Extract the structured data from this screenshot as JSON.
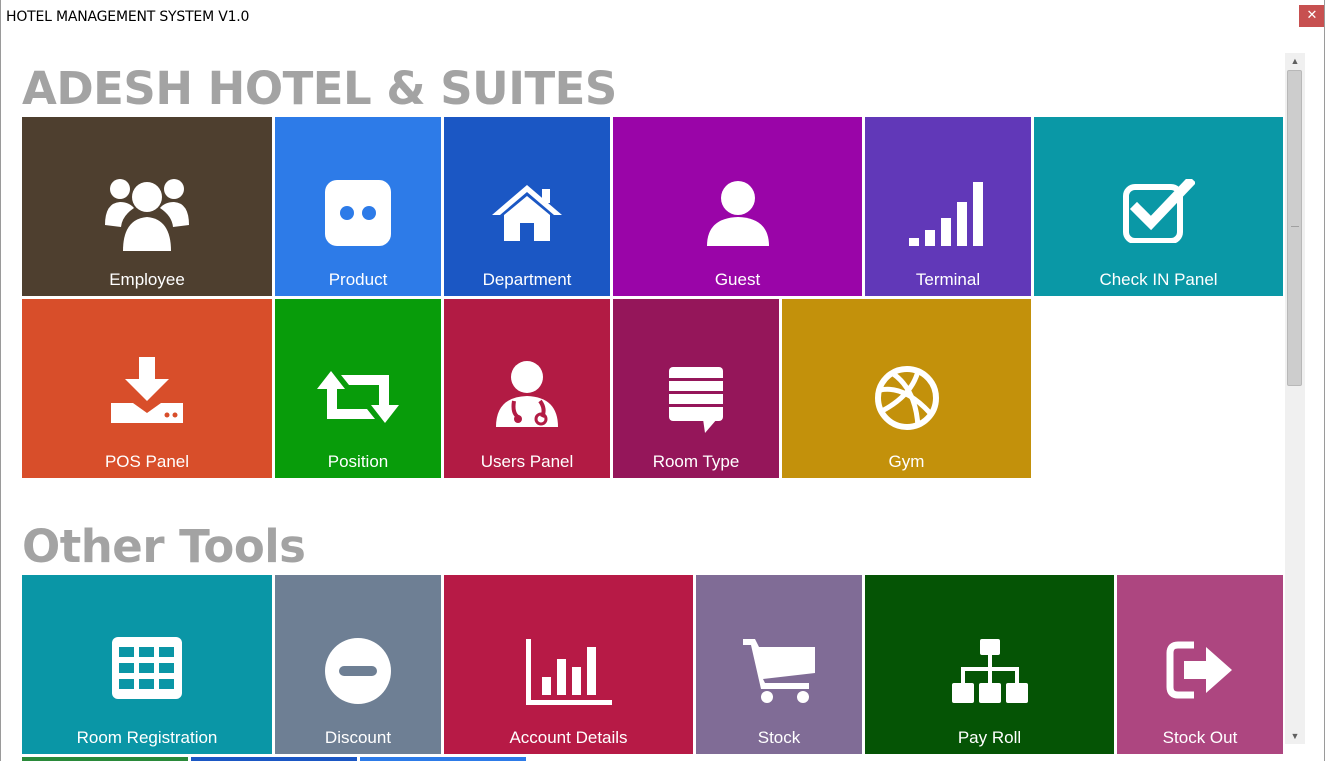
{
  "window": {
    "title": "HOTEL MANAGEMENT SYSTEM V1.0",
    "close_glyph": "✕"
  },
  "sections": {
    "main_heading": "ADESH HOTEL & SUITES",
    "other_heading": "Other Tools"
  },
  "tiles": {
    "employee": {
      "label": "Employee",
      "color": "#4e3f2f",
      "icon": "users-icon"
    },
    "product": {
      "label": "Product",
      "color": "#2d7be8",
      "icon": "flickr-icon"
    },
    "department": {
      "label": "Department",
      "color": "#1b57c4",
      "icon": "home-icon"
    },
    "guest": {
      "label": "Guest",
      "color": "#9a05a8",
      "icon": "user-icon"
    },
    "terminal": {
      "label": "Terminal",
      "color": "#6138b8",
      "icon": "signal-bars-icon"
    },
    "checkin": {
      "label": "Check IN Panel",
      "color": "#0a98a6",
      "icon": "checkbox-icon"
    },
    "pos": {
      "label": "POS Panel",
      "color": "#d84e2a",
      "icon": "download-icon"
    },
    "position": {
      "label": "Position",
      "color": "#089c0a",
      "icon": "retweet-icon"
    },
    "users_panel": {
      "label": "Users Panel",
      "color": "#b21b44",
      "icon": "doctor-icon"
    },
    "room_type": {
      "label": "Room Type",
      "color": "#95165a",
      "icon": "comment-lines-icon"
    },
    "gym": {
      "label": "Gym",
      "color": "#c3910b",
      "icon": "basketball-icon"
    },
    "room_registration": {
      "label": "Room Registration",
      "color": "#0a96a6",
      "icon": "grid-table-icon"
    },
    "discount": {
      "label": "Discount",
      "color": "#6e7f94",
      "icon": "minus-circle-icon"
    },
    "account_details": {
      "label": "Account Details",
      "color": "#b71a46",
      "icon": "bar-chart-icon"
    },
    "stock": {
      "label": "Stock",
      "color": "#806c96",
      "icon": "cart-icon"
    },
    "pay_roll": {
      "label": "Pay Roll",
      "color": "#055405",
      "icon": "sitemap-icon"
    },
    "stock_out": {
      "label": "Stock Out",
      "color": "#ad4680",
      "icon": "sign-out-icon"
    },
    "partial": {
      "colors": [
        "#2a8a3a",
        "#1b57c4",
        "#2d7be8"
      ]
    }
  },
  "scrollbar": {
    "up": "▲",
    "down": "▼",
    "position_fraction": 0.0
  }
}
